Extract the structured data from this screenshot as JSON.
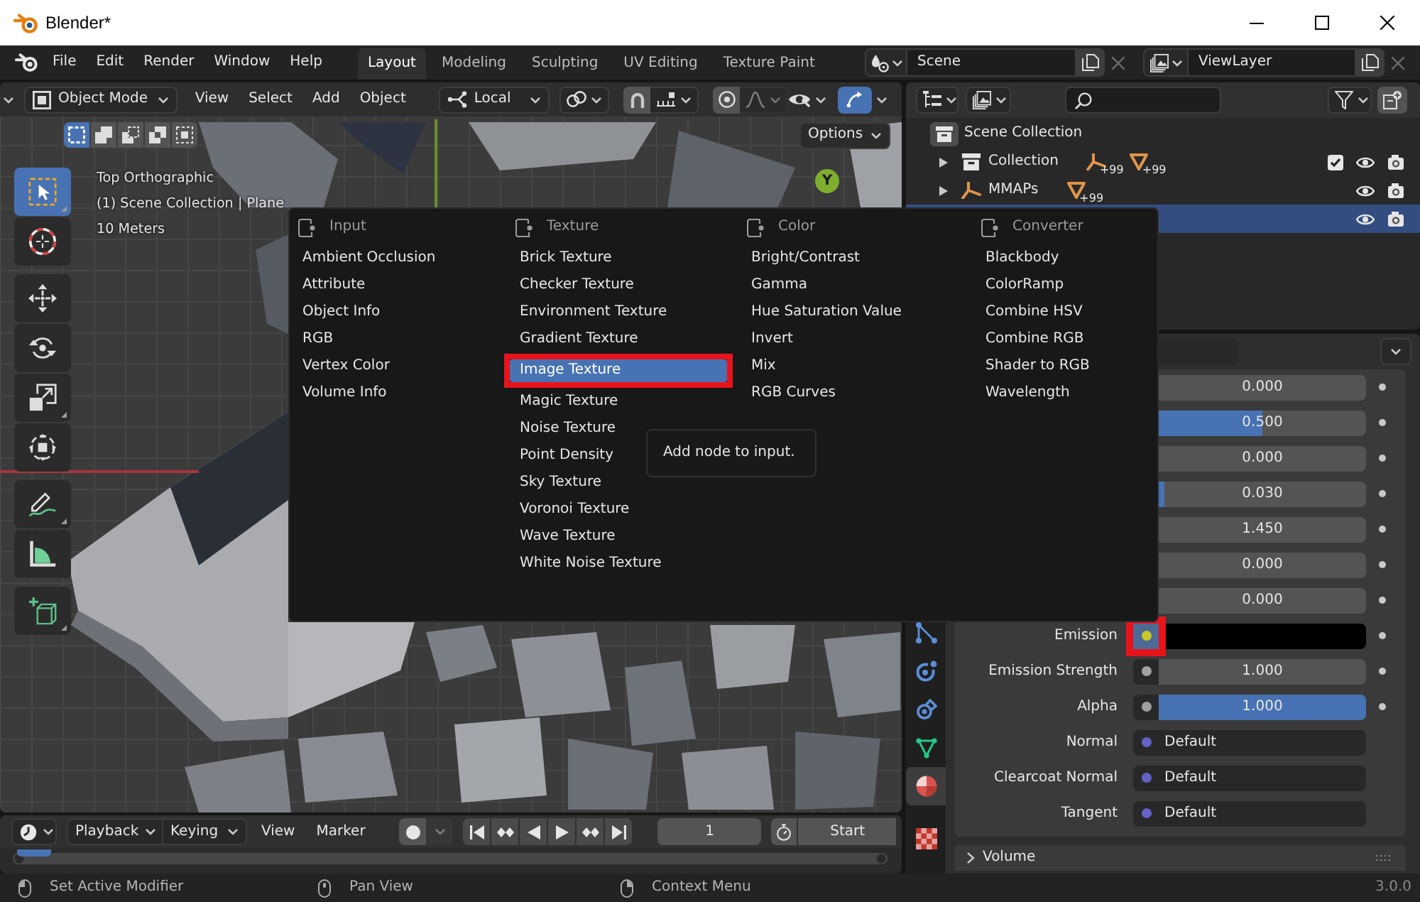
{
  "window": {
    "title": "Blender*"
  },
  "menubar": {
    "items": [
      "File",
      "Edit",
      "Render",
      "Window",
      "Help"
    ]
  },
  "workspaces": [
    {
      "label": "Layout",
      "selected": true
    },
    {
      "label": "Modeling",
      "selected": false
    },
    {
      "label": "Sculpting",
      "selected": false
    },
    {
      "label": "UV Editing",
      "selected": false
    },
    {
      "label": "Texture Paint",
      "selected": false
    }
  ],
  "scene": {
    "value": "Scene"
  },
  "view_layer": {
    "value": "ViewLayer"
  },
  "viewport": {
    "mode": "Object Mode",
    "menus": [
      "View",
      "Select",
      "Add",
      "Object"
    ],
    "orientation": "Local",
    "snap": {
      "on": false
    },
    "proportional": {
      "on": false
    },
    "falloff": {
      "disabled": true
    },
    "gizmos": {
      "on": true
    },
    "select_modes": [
      {
        "kind": "set",
        "selected": true
      },
      {
        "kind": "extend",
        "selected": false
      },
      {
        "kind": "subtract",
        "selected": false
      },
      {
        "kind": "difference",
        "selected": false
      },
      {
        "kind": "intersect",
        "selected": false
      }
    ],
    "options": "Options",
    "tool_groups": [
      {
        "tools": [
          {
            "kind": "select_box",
            "selected": true,
            "flyout": true
          },
          {
            "kind": "cursor",
            "selected": false,
            "flyout": false
          }
        ]
      },
      {
        "tools": [
          {
            "kind": "move",
            "selected": false,
            "flyout": false
          },
          {
            "kind": "rotate",
            "selected": false,
            "flyout": false
          },
          {
            "kind": "scale",
            "selected": false,
            "flyout": true
          },
          {
            "kind": "transform",
            "selected": false,
            "flyout": false
          }
        ]
      },
      {
        "tools": [
          {
            "kind": "annotate",
            "selected": false,
            "flyout": true
          },
          {
            "kind": "measure",
            "selected": false,
            "flyout": false
          }
        ]
      },
      {
        "tools": [
          {
            "kind": "add_cube",
            "selected": false,
            "flyout": true
          }
        ]
      }
    ],
    "overlay_text": [
      "Top Orthographic",
      "(1) Scene Collection | Plane",
      "10 Meters"
    ],
    "gizmo_axis": "Y"
  },
  "add_menu": {
    "columns": [
      {
        "title": "Input",
        "items": [
          {
            "label": "Ambient Occlusion",
            "selected": false,
            "marked": false
          },
          {
            "label": "Attribute",
            "selected": false,
            "marked": false
          },
          {
            "label": "Object Info",
            "selected": false,
            "marked": false
          },
          {
            "label": "RGB",
            "selected": false,
            "marked": false
          },
          {
            "label": "Vertex Color",
            "selected": false,
            "marked": false
          },
          {
            "label": "Volume Info",
            "selected": false,
            "marked": false
          }
        ]
      },
      {
        "title": "Texture",
        "items": [
          {
            "label": "Brick Texture",
            "selected": false,
            "marked": false
          },
          {
            "label": "Checker Texture",
            "selected": false,
            "marked": false
          },
          {
            "label": "Environment Texture",
            "selected": false,
            "marked": false
          },
          {
            "label": "Gradient Texture",
            "selected": false,
            "marked": false
          },
          {
            "label": "Image Texture",
            "selected": true,
            "marked": true
          },
          {
            "label": "Magic Texture",
            "selected": false,
            "marked": false
          },
          {
            "label": "Noise Texture",
            "selected": false,
            "marked": false
          },
          {
            "label": "Point Density",
            "selected": false,
            "marked": false
          },
          {
            "label": "Sky Texture",
            "selected": false,
            "marked": false
          },
          {
            "label": "Voronoi Texture",
            "selected": false,
            "marked": false
          },
          {
            "label": "Wave Texture",
            "selected": false,
            "marked": false
          },
          {
            "label": "White Noise Texture",
            "selected": false,
            "marked": false
          }
        ]
      },
      {
        "title": "Color",
        "items": [
          {
            "label": "Bright/Contrast",
            "selected": false,
            "marked": false
          },
          {
            "label": "Gamma",
            "selected": false,
            "marked": false
          },
          {
            "label": "Hue Saturation Value",
            "selected": false,
            "marked": false
          },
          {
            "label": "Invert",
            "selected": false,
            "marked": false
          },
          {
            "label": "Mix",
            "selected": false,
            "marked": false
          },
          {
            "label": "RGB Curves",
            "selected": false,
            "marked": false
          }
        ]
      },
      {
        "title": "Converter",
        "items": [
          {
            "label": "Blackbody",
            "selected": false,
            "marked": false
          },
          {
            "label": "ColorRamp",
            "selected": false,
            "marked": false
          },
          {
            "label": "Combine HSV",
            "selected": false,
            "marked": false
          },
          {
            "label": "Combine RGB",
            "selected": false,
            "marked": false
          },
          {
            "label": "Shader to RGB",
            "selected": false,
            "marked": false
          },
          {
            "label": "Wavelength",
            "selected": false,
            "marked": false
          }
        ]
      }
    ]
  },
  "tooltip": {
    "text": "Add node to input."
  },
  "outliner": {
    "tree": [
      {
        "name": "Scene Collection",
        "kind": "scene_collection",
        "selected": false,
        "children": [
          {
            "name": "Collection",
            "kind": "collection",
            "selected": false,
            "expanded": false,
            "checked": true,
            "badges": [
              {
                "kind": "armature",
                "count": "+99"
              },
              {
                "kind": "mesh",
                "count": "+99"
              }
            ]
          },
          {
            "name": "MMAPs",
            "kind": "armature",
            "selected": false,
            "expanded": false,
            "badges": [
              {
                "kind": "mesh",
                "count": "+99"
              }
            ]
          },
          {
            "kind": "object",
            "selected": true
          }
        ]
      }
    ]
  },
  "properties": {
    "tabs": [
      {
        "kind": "particles",
        "selected": false
      },
      {
        "kind": "physics",
        "selected": false
      },
      {
        "kind": "constraints",
        "selected": false
      },
      {
        "kind": "data",
        "selected": false
      },
      {
        "kind": "material",
        "selected": true
      },
      {
        "kind": "texture",
        "selected": false
      }
    ],
    "rows": [
      {
        "kind": "number",
        "value": "0.000"
      },
      {
        "kind": "slider",
        "value": "0.500",
        "level": 0.5
      },
      {
        "kind": "number",
        "value": "0.000"
      },
      {
        "kind": "slider",
        "value": "0.030",
        "level": 0.03
      },
      {
        "kind": "number",
        "value": "1.450"
      },
      {
        "kind": "number",
        "value": "0.000"
      },
      {
        "kind": "number",
        "value": "0.000"
      },
      {
        "kind": "color",
        "label": "Emission",
        "socket": {
          "color": "#c7c729",
          "hovered": true,
          "marked": true
        }
      },
      {
        "kind": "number",
        "label": "Emission Strength",
        "value": "1.000",
        "socket": {
          "color": "#a1a1a1",
          "hovered": false,
          "marked": false
        }
      },
      {
        "kind": "slider",
        "label": "Alpha",
        "value": "1.000",
        "level": 1,
        "socket": {
          "color": "#a1a1a1",
          "hovered": false,
          "marked": false
        }
      },
      {
        "kind": "vector",
        "label": "Normal",
        "value": "Default",
        "socket": {
          "color": "#6363c7"
        }
      },
      {
        "kind": "vector",
        "label": "Clearcoat Normal",
        "value": "Default",
        "socket": {
          "color": "#6363c7"
        }
      },
      {
        "kind": "vector",
        "label": "Tangent",
        "value": "Default",
        "socket": {
          "color": "#6363c7"
        }
      }
    ],
    "panels": [
      {
        "title": "Volume",
        "expanded": false
      }
    ]
  },
  "timeline": {
    "menus": [
      {
        "label": "Playback",
        "dropdown": true
      },
      {
        "label": "Keying",
        "dropdown": true
      },
      {
        "label": "View",
        "dropdown": false
      },
      {
        "label": "Marker",
        "dropdown": false
      }
    ],
    "auto_keying": {
      "on": false
    },
    "frame": "1",
    "start_label": "Start"
  },
  "status_bar": {
    "hints": [
      {
        "kind": "left",
        "label": "Set Active Modifier"
      },
      {
        "kind": "middle",
        "label": "Pan View"
      },
      {
        "kind": "right",
        "label": "Context Menu"
      }
    ],
    "version": "3.0.0"
  }
}
